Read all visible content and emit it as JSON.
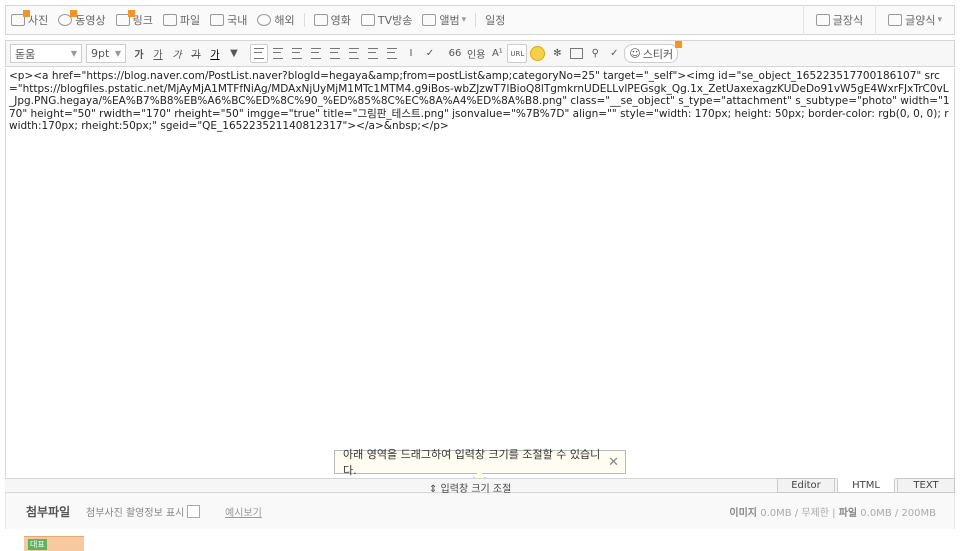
{
  "toolbar1": {
    "left": [
      {
        "label": "사진",
        "icon": "photo-icon",
        "new": true
      },
      {
        "label": "동영상",
        "icon": "video-icon",
        "new": true
      },
      {
        "label": "링크",
        "icon": "link-icon",
        "new": true
      },
      {
        "label": "파일",
        "icon": "file-icon",
        "new": false
      },
      {
        "label": "국내",
        "icon": "map-icon",
        "new": false
      },
      {
        "label": "해외",
        "icon": "globe-icon",
        "new": false
      },
      {
        "label": "영화",
        "icon": "film-icon",
        "new": false
      },
      {
        "label": "TV방송",
        "icon": "tv-icon",
        "new": false
      },
      {
        "label": "앨범",
        "icon": "album-icon",
        "new": false
      },
      {
        "label": "일정",
        "icon": "",
        "new": false
      }
    ],
    "right": [
      {
        "label": "글장식",
        "icon": "pencil-icon"
      },
      {
        "label": "글양식",
        "icon": "template-icon"
      }
    ]
  },
  "toolbar2": {
    "font": "돋움",
    "size": "9pt",
    "quote": "66",
    "special": "인용",
    "sticker": "스티커",
    "url": "URL"
  },
  "editor": {
    "html": "<p><a href=\"https://blog.naver.com/PostList.naver?blogId=hegaya&amp;from=postList&amp;categoryNo=25\" target=\"_self\"><img id=\"se_object_165223517700186107\" src=\"https://blogfiles.pstatic.net/MjAyMjA1MTFfNiAg/MDAxNjUyMjM1MTc1MTM4.g9iBos-wbZJzwT7lBioQ8lTgmkrnUDELLvlPEGsgk_Qg.1x_ZetUaxexagzKUDeDo91vW5gE4WxrFJxTrC0vL_Jpg.PNG.hegaya/%EA%B7%B8%EB%A6%BC%ED%8C%90_%ED%85%8C%EC%8A%A4%ED%8A%B8.png\" class=\"__se_object\" s_type=\"attachment\" s_subtype=\"photo\" width=\"170\" height=\"50\" rwidth=\"170\" rheight=\"50\" imgge=\"true\" title=\"그림판_테스트.png\" jsonvalue=\"%7B%7D\" align=\"\" style=\"width: 170px; height: 50px; border-color: rgb(0, 0, 0); rwidth:170px; rheight:50px;\" sgeid=\"QE_165223521140812317\"></a>&nbsp;</p>"
  },
  "tooltip": {
    "text": "아래 영역을 드래그하여 입력창 크기를 조절할 수 있습니다.",
    "close": "✕"
  },
  "resize": {
    "label": "⇕ 입력창 크기 조절"
  },
  "modes": [
    "Editor",
    "HTML",
    "TEXT"
  ],
  "attachments": {
    "title": "첨부파일",
    "show_info": "첨부사진 촬영정보 표시",
    "preview": "예시보기",
    "image_label": "이미지",
    "image_size": "0.0MB",
    "image_limit": "무제한",
    "file_label": "파일",
    "file_size": "0.0MB",
    "file_limit": "200MB",
    "thumb_badge": "대표"
  }
}
